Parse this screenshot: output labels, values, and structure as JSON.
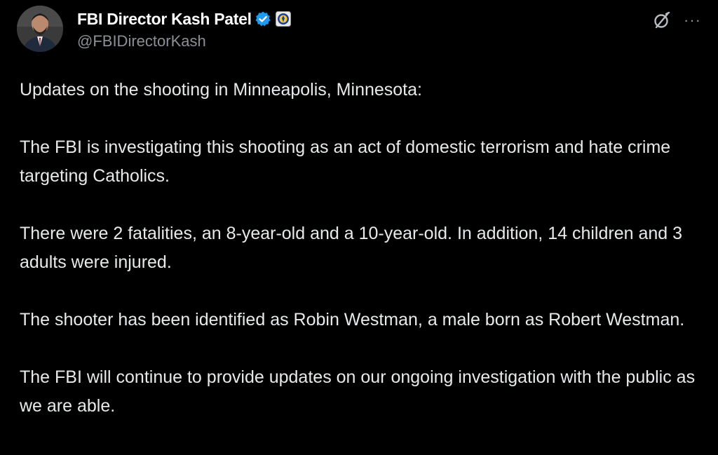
{
  "author": {
    "display_name": "FBI Director Kash Patel",
    "handle": "@FBIDirectorKash",
    "verified_badge_color": "#1d9bf0",
    "affiliate_badge_icon": "fbi-seal-icon",
    "avatar_icon": "profile-photo"
  },
  "actions": {
    "grok_icon": "grok-icon",
    "more_label": "···"
  },
  "post": {
    "paragraphs": [
      "Updates on the shooting in Minneapolis, Minnesota:",
      "The FBI is investigating this shooting as an act of domestic terrorism and hate crime targeting Catholics.",
      "There were 2 fatalities, an 8-year-old and a 10-year-old. In addition, 14 children and 3 adults were injured.",
      "The shooter has been identified as Robin Westman, a male born as Robert Westman.",
      "The FBI will continue to provide updates on our ongoing investigation with the public as we are able."
    ]
  },
  "theme": {
    "background": "#000000",
    "text": "#e7e9ea",
    "secondary_text": "#8b9096"
  }
}
